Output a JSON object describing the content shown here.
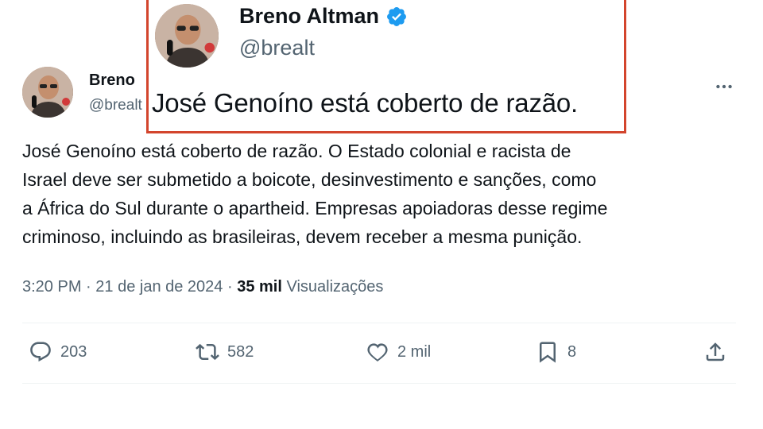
{
  "tweet": {
    "author_name": "Breno",
    "author_handle": "@brealt",
    "text_lines": [
      "José Genoíno está coberto de razão. O Estado colonial e racista de",
      "Israel deve ser submetido a boicote, desinvestimento e sanções, como",
      "a África do Sul durante o apartheid. Empresas apoiadoras desse regime",
      "criminoso, incluindo as brasileiras, devem receber a mesma punição."
    ],
    "time": "3:20 PM",
    "separator": " · ",
    "date": "21 de jan de 2024",
    "views_count": "35 mil",
    "views_label": " Visualizações"
  },
  "actions": {
    "replies": "203",
    "retweets": "582",
    "likes": "2 mil",
    "bookmarks": "8"
  },
  "callout": {
    "name": "Breno Altman",
    "handle": "@brealt",
    "text": "José Genoíno está coberto de razão."
  },
  "colors": {
    "text": "#0f1419",
    "secondary": "#536471",
    "divider": "#eff3f4",
    "verified": "#1d9bf0",
    "callout_border": "#d3452d"
  },
  "icons": [
    "more-icon",
    "reply-icon",
    "retweet-icon",
    "like-icon",
    "bookmark-icon",
    "share-icon",
    "verified-icon"
  ]
}
